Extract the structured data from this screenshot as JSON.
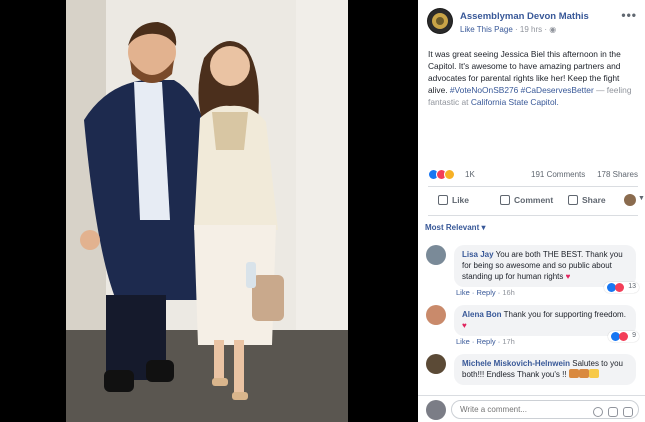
{
  "post": {
    "page_name": "Assemblyman Devon Mathis",
    "like_page": "Like This Page",
    "time": "19 hrs",
    "text_main": "It was great seeing Jessica Biel this afternoon in the Capitol. It's awesome to have amazing partners and advocates for parental rights like her! Keep the fight alive.",
    "hashtag1": "#VoteNoOnSB276",
    "hashtag2": "#CaDeservesBetter",
    "feeling": "— feeling fantastic at",
    "location": "California State Capitol."
  },
  "stats": {
    "reactions": "1K",
    "comments": "191 Comments",
    "shares": "178 Shares"
  },
  "actions": {
    "like": "Like",
    "comment": "Comment",
    "share": "Share"
  },
  "sort_label": "Most Relevant",
  "comments": [
    {
      "name": "Lisa Jay",
      "text": "You are both THE BEST. Thank you for being so awesome and so public about standing up for human rights",
      "like": "Like",
      "reply": "Reply",
      "time": "16h",
      "reactions": "13"
    },
    {
      "name": "Alena Bon",
      "text": "Thank you for supporting freedom.",
      "like": "Like",
      "reply": "Reply",
      "time": "17h",
      "reactions": "9"
    },
    {
      "name": "Michele Miskovich-Helnwein",
      "text": "Salutes to you both!!! Endless Thank you's !!"
    }
  ],
  "write_comment": {
    "placeholder": "Write a comment..."
  },
  "colors": {
    "link": "#385898",
    "muted": "#90949c",
    "bubble": "#f2f3f5"
  }
}
